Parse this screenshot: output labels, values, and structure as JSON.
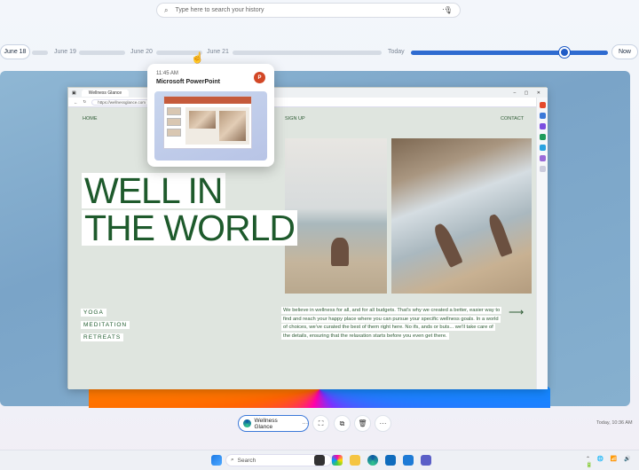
{
  "search": {
    "placeholder": "Type here to search your history",
    "more_label": "···"
  },
  "timeline": {
    "dates": [
      "June 18",
      "June 19",
      "June 20",
      "June 21",
      "Today"
    ],
    "now_label": "Now"
  },
  "hover_card": {
    "time": "11:45 AM",
    "app": "Microsoft PowerPoint",
    "app_badge": "P"
  },
  "browser": {
    "tab_title": "Wellness Glance",
    "url": "https://wellnessglance.com",
    "window_controls": "– ▢ ✕",
    "site": {
      "nav": {
        "home": "HOME",
        "signup": "SIGN UP",
        "contact": "CONTACT"
      },
      "headline_line1": "WELL IN",
      "headline_line2": "THE WORLD",
      "services": [
        "YOGA",
        "MEDITATION",
        "RETREATS"
      ],
      "blurb": "We believe in wellness for all, and for all budgets. That's why we created a better, easier way to find and reach your happy place where you can pursue your specific wellness goals. In a world of choices, we've curated the best of them right here. No ifs, ands or buts... we'll take care of the details, ensuring that the relaxation starts before you even get there.",
      "arrow": "⟶"
    }
  },
  "toolbar": {
    "app_chip_label": "Wellness Glance",
    "app_chip_more": "···",
    "more_label": "···",
    "timestamp": "Today, 10:36 AM"
  },
  "taskbar": {
    "search_placeholder": "Search",
    "tray": "⌃ 🌐 📶 🔊 🔋"
  },
  "colors": {
    "accent": "#2f6bd0",
    "site_green": "#1e5a2c",
    "ppt": "#d24726"
  }
}
